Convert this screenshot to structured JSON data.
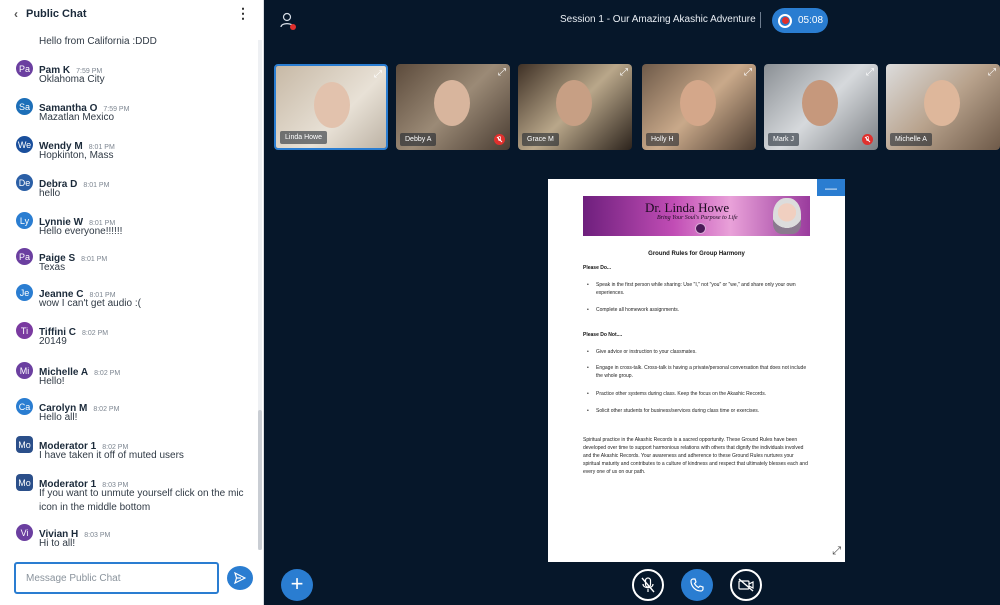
{
  "chat": {
    "header_title": "Public Chat",
    "composer_placeholder": "Message Public Chat",
    "partial_message": "Hello from California :DDD",
    "messages": [
      {
        "initials": "Pa",
        "name": "Pam K",
        "time": "7:59 PM",
        "text": "Oklahoma City",
        "color": "#6b3fa0"
      },
      {
        "initials": "Sa",
        "name": "Samantha O",
        "time": "7:59 PM",
        "text": "Mazatlan Mexico",
        "color": "#1d6fb8"
      },
      {
        "initials": "We",
        "name": "Wendy M",
        "time": "8:01 PM",
        "text": "Hopkinton, Mass",
        "color": "#1a4f9c"
      },
      {
        "initials": "De",
        "name": "Debra D",
        "time": "8:01 PM",
        "text": "hello",
        "color": "#2b5fa6"
      },
      {
        "initials": "Ly",
        "name": "Lynnie W",
        "time": "8:01 PM",
        "text": "Hello everyone!!!!!!",
        "color": "#2a7dd1"
      },
      {
        "initials": "Pa",
        "name": "Paige S",
        "time": "8:01 PM",
        "text": "Texas",
        "color": "#6b3fa0"
      },
      {
        "initials": "Je",
        "name": "Jeanne C",
        "time": "8:01 PM",
        "text": "wow I can't get audio :(",
        "color": "#2a7dd1"
      },
      {
        "initials": "Ti",
        "name": "Tiffini C",
        "time": "8:02 PM",
        "text": "20149",
        "color": "#7a3aa0"
      },
      {
        "initials": "Mi",
        "name": "Michelle A",
        "time": "8:02 PM",
        "text": "Hello!",
        "color": "#6b3fa0"
      },
      {
        "initials": "Ca",
        "name": "Carolyn M",
        "time": "8:02 PM",
        "text": "Hello all!",
        "color": "#2a7dd1"
      },
      {
        "initials": "Mo",
        "name": "Moderator 1",
        "time": "8:02 PM",
        "text": "I have taken it off of muted users",
        "color": "#2b4f8a"
      },
      {
        "initials": "Mo",
        "name": "Moderator 1",
        "time": "8:03 PM",
        "text": "If you want to unmute yourself click on the mic icon in the middle bottom",
        "color": "#2b4f8a"
      },
      {
        "initials": "Vi",
        "name": "Vivian H",
        "time": "8:03 PM",
        "text": "Hi to all!",
        "color": "#6b3fa0"
      }
    ]
  },
  "header": {
    "session_title": "Session 1 - Our Amazing Akashic Adventure",
    "recording_time": "05:08",
    "recording_color": "#e0302d"
  },
  "participants": [
    {
      "name": "Linda Howe",
      "muted": false,
      "active": true
    },
    {
      "name": "Debby A",
      "muted": true,
      "active": false
    },
    {
      "name": "Grace M",
      "muted": false,
      "active": false
    },
    {
      "name": "Holly H",
      "muted": false,
      "active": false
    },
    {
      "name": "Mark J",
      "muted": true,
      "active": false
    },
    {
      "name": "Michelle A",
      "muted": false,
      "active": false
    }
  ],
  "slide": {
    "banner_title": "Dr. Linda Howe",
    "banner_subtitle": "Bring Your Soul's Purpose to Life",
    "doc_title": "Ground Rules for Group Harmony",
    "do_heading": "Please Do...",
    "do_items": [
      "Speak in the first person while sharing: Use \"I,\" not \"you\" or \"we,\" and share only your own experiences.",
      "Complete all homework assignments."
    ],
    "dont_heading": "Please Do Not....",
    "dont_items": [
      "Give advice or instruction to your classmates.",
      "Engage in cross-talk. Cross-talk is having a private/personal conversation that does not include the whole group.",
      "Practice other systems during class. Keep the focus on the Akashic Records.",
      "Solicit other students for business/services during class time or exercises."
    ],
    "closing_paragraph": "Spiritual practice in the Akashic Records is a sacred opportunity. These Ground Rules have been developed over time to support harmonious relations with others that dignify the individuals involved and the Akashic Records. Your awareness and adherence to these Ground Rules nurtures your spiritual maturity and contributes to a culture of kindness and respect that ultimately blesses each and every one of us on our path."
  },
  "theme": {
    "accent": "#2a7dd1",
    "background": "#06172a",
    "muted_red": "#e0302d"
  }
}
